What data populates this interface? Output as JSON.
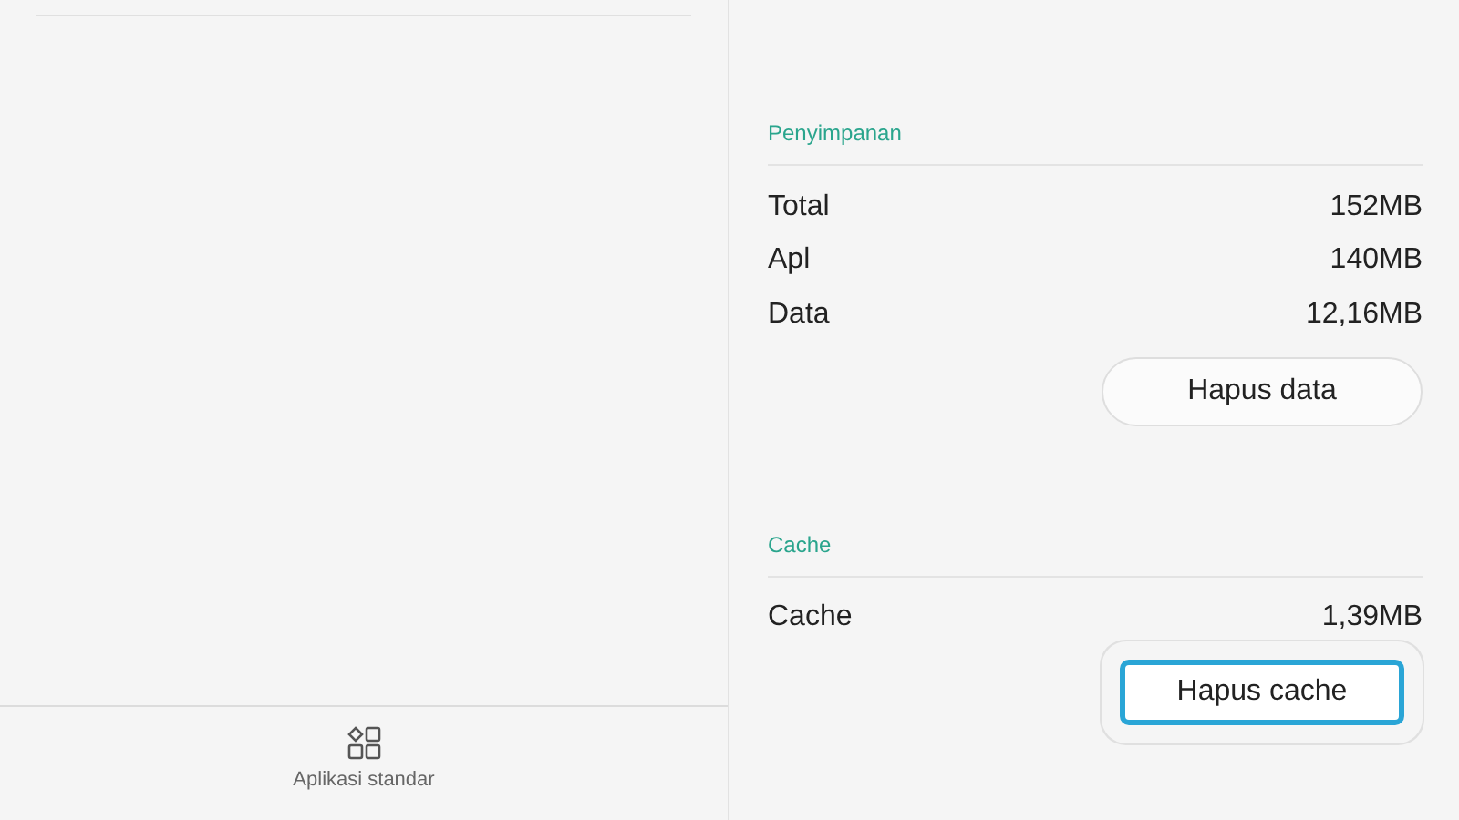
{
  "left_panel": {
    "bottom_bar": {
      "label": "Aplikasi standar"
    }
  },
  "sections": [
    {
      "title": "Penyimpanan",
      "rows": [
        {
          "label": "Total",
          "value": "152MB"
        },
        {
          "label": "Apl",
          "value": "140MB"
        },
        {
          "label": "Data",
          "value": "12,16MB"
        }
      ],
      "button": {
        "label": "Hapus data",
        "highlighted": false
      }
    },
    {
      "title": "Cache",
      "rows": [
        {
          "label": "Cache",
          "value": "1,39MB"
        }
      ],
      "button": {
        "label": "Hapus cache",
        "highlighted": true
      }
    }
  ]
}
